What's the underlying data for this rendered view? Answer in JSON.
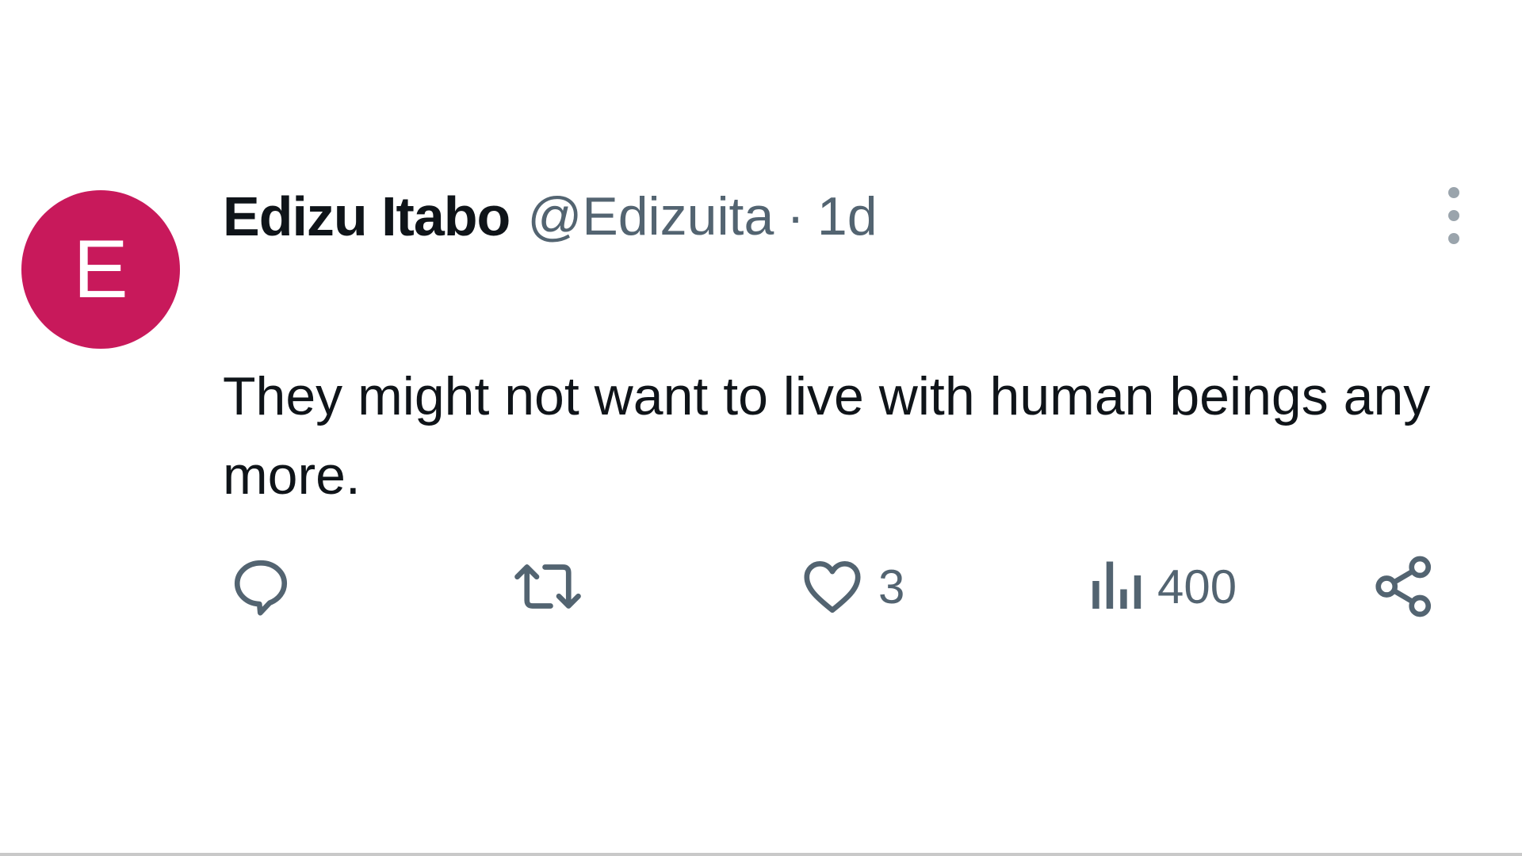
{
  "author": {
    "avatar_initial": "E",
    "avatar_color": "#c8195b",
    "display_name": "Edizu Itabo",
    "handle": "@Edizuita",
    "separator": "·",
    "time": "1d"
  },
  "tweet": {
    "text": "They might not want to live with human beings any more."
  },
  "actions": {
    "reply": {
      "icon": "reply-icon"
    },
    "retweet": {
      "icon": "retweet-icon"
    },
    "like": {
      "icon": "heart-icon",
      "count": "3"
    },
    "views": {
      "icon": "views-icon",
      "count": "400"
    },
    "share": {
      "icon": "share-icon"
    }
  },
  "colors": {
    "text_primary": "#0f1419",
    "text_secondary": "#536471"
  }
}
